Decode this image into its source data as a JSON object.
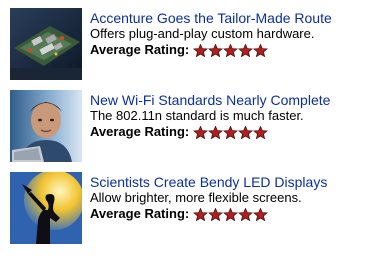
{
  "articles": [
    {
      "headline": "Accenture Goes the Tailor-Made Route",
      "summary": "Offers plug-and-play custom hardware.",
      "rating_label": "Average Rating:",
      "rating_stars": 5,
      "thumbnail_icon": "circuit-board-image"
    },
    {
      "headline": "New Wi-Fi Standards Nearly Complete",
      "summary": "The 802.11n standard is much faster.",
      "rating_label": "Average Rating:",
      "rating_stars": 5,
      "thumbnail_icon": "person-with-laptop-image"
    },
    {
      "headline": "Scientists Create Bendy LED Displays",
      "summary": "Allow brighter, more flexible screens.",
      "rating_label": "Average Rating:",
      "rating_stars": 5,
      "thumbnail_icon": "person-with-light-image"
    }
  ],
  "colors": {
    "headline": "#0b2fa3",
    "star_red": "#b31d1d",
    "star_dark": "#4a1010"
  }
}
